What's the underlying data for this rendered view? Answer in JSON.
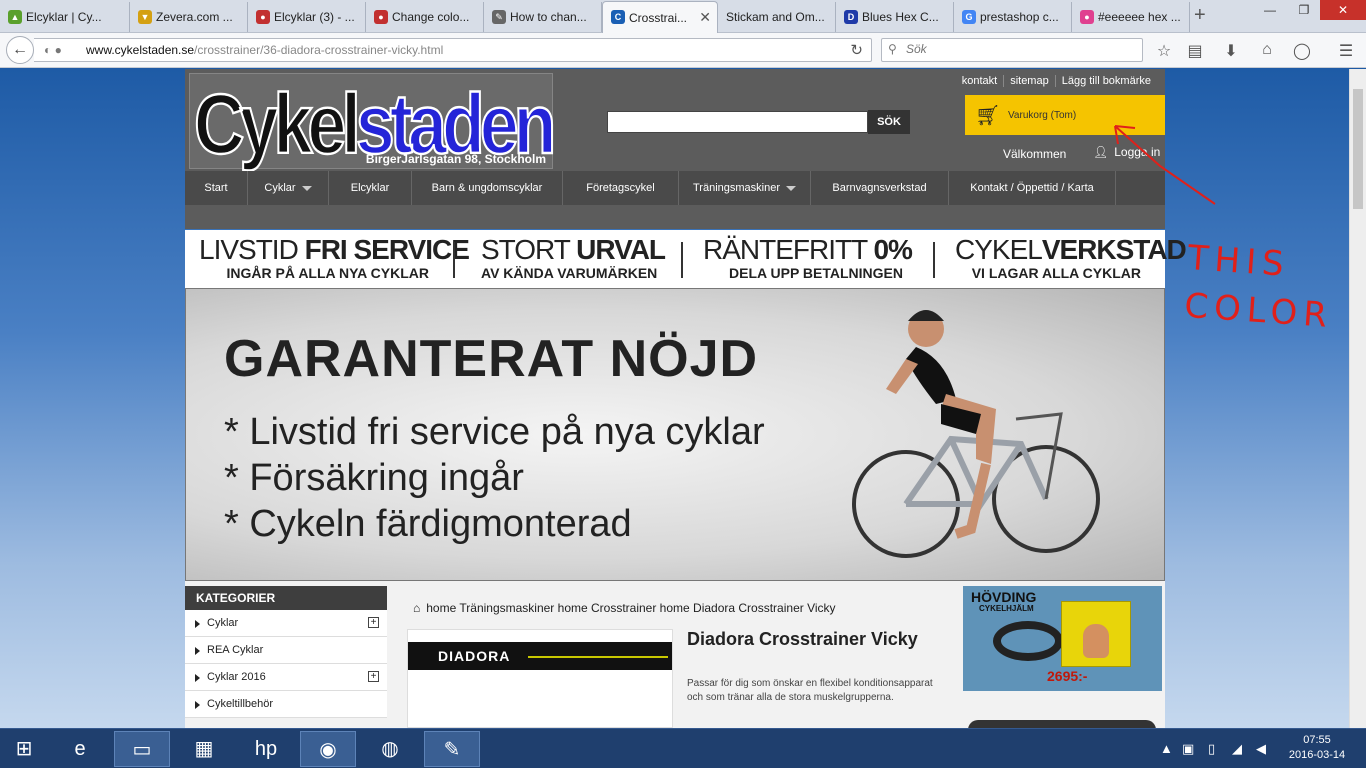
{
  "browser": {
    "tabs": [
      {
        "label": "Elcyklar | Cy...",
        "icon_color": "#5aa02c"
      },
      {
        "label": "Zevera.com ...",
        "icon_color": "#d4a012"
      },
      {
        "label": "Elcyklar (3) - ...",
        "icon_color": "#c23030"
      },
      {
        "label": "Change colo...",
        "icon_color": "#c23030"
      },
      {
        "label": "How to chan...",
        "icon_color": "#666666"
      },
      {
        "label": "Crosstrai...",
        "icon_color": "#1a5fb4"
      },
      {
        "label": "Stickam and Om...",
        "icon_color": "#ffffff"
      },
      {
        "label": "Blues Hex C...",
        "icon_color": "#1f3aa8"
      },
      {
        "label": "prestashop c...",
        "icon_color": "#4285f4"
      },
      {
        "label": "#eeeeee hex ...",
        "icon_color": "#e04090"
      }
    ],
    "url_domain": "www.cykelstaden.se",
    "url_path": "/crosstrainer/36-diadora-crosstrainer-vicky.html",
    "search_placeholder": "Sök",
    "window_controls": {
      "minimize": "—",
      "restore": "❐",
      "close": "✕"
    }
  },
  "site": {
    "logo_part1": "Cykel",
    "logo_part2": "staden",
    "address": "BirgerJarlsgatan 98, Stockholm",
    "top_links": [
      "kontakt",
      "sitemap",
      "Lägg till bokmärke"
    ],
    "search_button": "SÖK",
    "cart_label": "Varukorg (Tom)",
    "cart_color": "#f5c400",
    "welcome": "Välkommen",
    "login": "Logga in",
    "menu": [
      {
        "label": "Start",
        "dropdown": false
      },
      {
        "label": "Cyklar",
        "dropdown": true
      },
      {
        "label": "Elcyklar",
        "dropdown": false
      },
      {
        "label": "Barn & ungdomscyklar",
        "dropdown": false
      },
      {
        "label": "Företagscykel",
        "dropdown": false
      },
      {
        "label": "Träningsmaskiner",
        "dropdown": true
      },
      {
        "label": "Barnvagnsverkstad",
        "dropdown": false
      },
      {
        "label": "Kontakt / Öppettid / Karta",
        "dropdown": false
      }
    ],
    "promos": [
      {
        "line1_a": "LIVSTID ",
        "line1_b": "FRI SERVICE",
        "line2": "INGÅR PÅ ALLA NYA CYKLAR"
      },
      {
        "line1_a": "STORT ",
        "line1_b": "URVAL",
        "line2": "AV KÄNDA VARUMÄRKEN"
      },
      {
        "line1_a": "RÄNTEFRITT ",
        "line1_b": "0%",
        "line2": "DELA UPP BETALNINGEN"
      },
      {
        "line1_a": "CYKEL",
        "line1_b": "VERKSTAD",
        "line2": "VI LAGAR ALLA CYKLAR"
      }
    ],
    "hero": {
      "title": "GARANTERAT NÖJD",
      "lines": [
        "* Livstid fri service på nya cyklar",
        "* Försäkring ingår",
        "* Cykeln färdigmonterad"
      ]
    },
    "categories": {
      "heading": "KATEGORIER",
      "items": [
        {
          "label": "Cyklar",
          "expandable": true
        },
        {
          "label": "REA Cyklar",
          "expandable": false
        },
        {
          "label": "Cyklar 2016",
          "expandable": true
        },
        {
          "label": "Cykeltillbehör",
          "expandable": false
        }
      ]
    },
    "breadcrumb": "home  Träningsmaskiner  home Crosstrainer  home Diadora Crosstrainer Vicky",
    "product": {
      "brand": "DIADORA",
      "title": "Diadora Crosstrainer Vicky",
      "description": "Passar för dig som önskar en flexibel konditionsapparat och som tränar alla de stora muskelgrupperna."
    },
    "ad": {
      "title": "HÖVDING",
      "subtitle": "CYKELHJÄLM",
      "price": "2695:-"
    }
  },
  "annotation": {
    "line1": "THIS",
    "line2": "COLOR",
    "color": "#e0201a"
  },
  "taskbar": {
    "time": "07:55",
    "date": "2016-03-14"
  }
}
